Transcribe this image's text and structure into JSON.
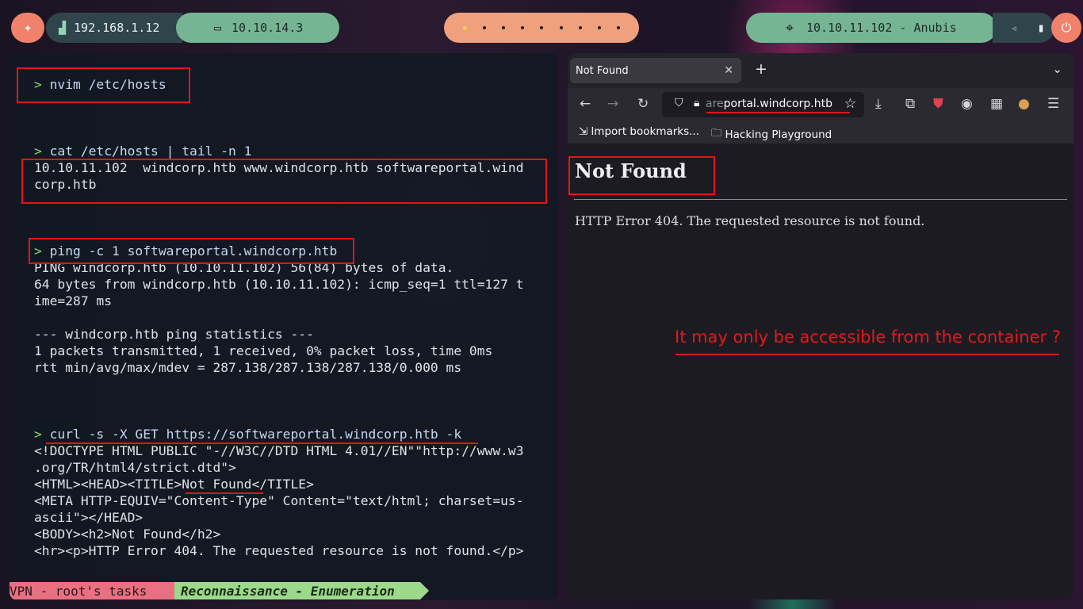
{
  "topbar": {
    "lan_ip": "192.168.1.12",
    "vpn_ip": "10.10.14.3",
    "target": "10.10.11.102 - Anubis",
    "workspace_count": 9
  },
  "terminal": {
    "lines": [
      {
        "prompt": "> ",
        "text": "nvim /etc/hosts"
      },
      {
        "prompt": "> ",
        "text": "cat /etc/hosts | tail -n 1"
      },
      {
        "text": "10.10.11.102  windcorp.htb www.windcorp.htb softwareportal.wind"
      },
      {
        "text": "corp.htb"
      },
      {
        "prompt": "> ",
        "text": "ping -c 1 softwareportal.windcorp.htb"
      },
      {
        "text": "PING windcorp.htb (10.10.11.102) 56(84) bytes of data."
      },
      {
        "text": "64 bytes from windcorp.htb (10.10.11.102): icmp_seq=1 ttl=127 t"
      },
      {
        "text": "ime=287 ms"
      },
      {
        "text": "--- windcorp.htb ping statistics ---"
      },
      {
        "text": "1 packets transmitted, 1 received, 0% packet loss, time 0ms"
      },
      {
        "text": "rtt min/avg/max/mdev = 287.138/287.138/287.138/0.000 ms"
      },
      {
        "prompt": "> ",
        "text": "curl -s -X GET https://softwareportal.windcorp.htb -k"
      },
      {
        "text": "<!DOCTYPE HTML PUBLIC \"-//W3C//DTD HTML 4.01//EN\"\"http://www.w3"
      },
      {
        "text": ".org/TR/html4/strict.dtd\">"
      },
      {
        "text": "<HTML><HEAD><TITLE>Not Found</TITLE>"
      },
      {
        "text": "<META HTTP-EQUIV=\"Content-Type\" Content=\"text/html; charset=us-"
      },
      {
        "text": "ascii\"></HEAD>"
      },
      {
        "text": "<BODY><h2>Not Found</h2>"
      },
      {
        "text": "<hr><p>HTTP Error 404. The requested resource is not found.</p>"
      }
    ],
    "status_left": "VPN - root's tasks",
    "status_right": "Reconnaissance - Enumeration"
  },
  "browser": {
    "tab_title": "Not Found",
    "url_hidden": "are",
    "url_visible": "portal.windcorp.htb",
    "bookmarks": [
      "Import bookmarks...",
      "Hacking Playground"
    ],
    "page_heading": "Not Found",
    "page_text": "HTTP Error 404. The requested resource is not found."
  },
  "annotation": "It may only be accessible from the container ?",
  "colors": {
    "annotation": "#e21a1a",
    "accent_green": "#75b594",
    "accent_orange": "#f0826b"
  }
}
